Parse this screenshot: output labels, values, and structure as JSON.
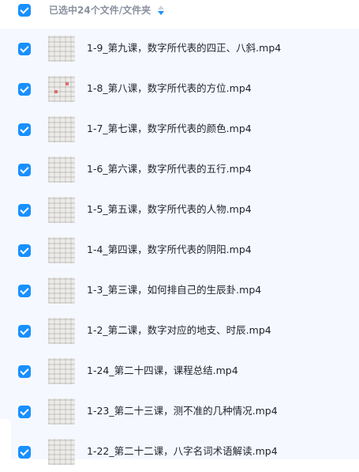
{
  "header": {
    "selected_text": "已选中24个文件/文件夹",
    "sort_icon": "sort-up-down-icon"
  },
  "colors": {
    "accent": "#1890ff",
    "list_bg": "#f5f9ff",
    "header_text": "#8a919f"
  },
  "files": [
    {
      "name": "1-9_第九课，数字所代表的四正、八斜.mp4",
      "checked": true
    },
    {
      "name": "1-8_第八课，数字所代表的方位.mp4",
      "checked": true
    },
    {
      "name": "1-7_第七课，数字所代表的颜色.mp4",
      "checked": true
    },
    {
      "name": "1-6_第六课，数字所代表的五行.mp4",
      "checked": true
    },
    {
      "name": "1-5_第五课，数字所代表的人物.mp4",
      "checked": true
    },
    {
      "name": "1-4_第四课，数字所代表的阴阳.mp4",
      "checked": true
    },
    {
      "name": "1-3_第三课，如何排自己的生辰卦.mp4",
      "checked": true
    },
    {
      "name": "1-2_第二课，数字对应的地支、时辰.mp4",
      "checked": true
    },
    {
      "name": "1-24_第二十四课，课程总结.mp4",
      "checked": true
    },
    {
      "name": "1-23_第二十三课，测不准的几种情况.mp4",
      "checked": true
    },
    {
      "name": "1-22_第二十二课，八字名词术语解读.mp4",
      "checked": true
    }
  ]
}
